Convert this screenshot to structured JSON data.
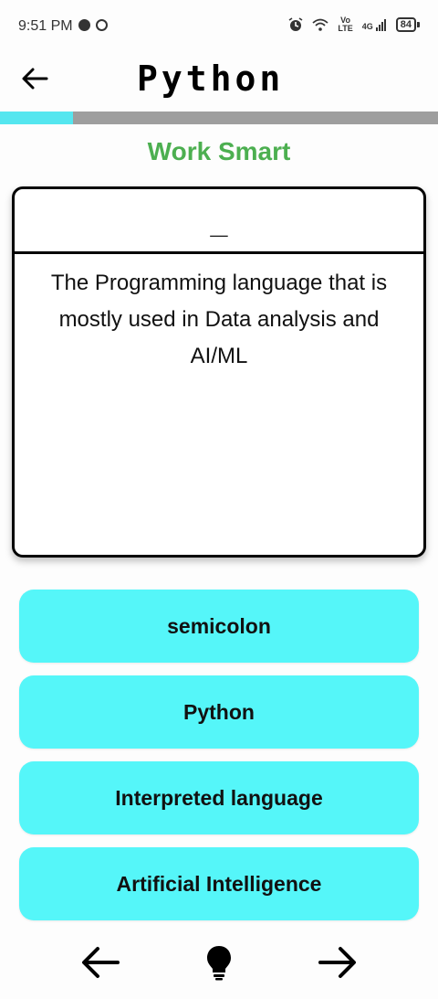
{
  "status_bar": {
    "time": "9:51 PM",
    "left_icons": [
      "messenger-icon",
      "notification-icon"
    ],
    "right_icons": [
      "alarm-icon",
      "wifi-icon",
      "volte-icon",
      "signal-4g-icon"
    ],
    "vo_label": "Vo",
    "lte_label": "LTE",
    "network_label": "4G",
    "battery": "84"
  },
  "header": {
    "title": "Python"
  },
  "progress": {
    "fraction": 0.167,
    "fill_color": "#55e6ef",
    "track_color": "#9e9e9e"
  },
  "subtitle": "Work Smart",
  "card": {
    "answer": "_",
    "question": "The Programming language that is mostly used in Data analysis and AI/ML"
  },
  "options": [
    {
      "label": "semicolon"
    },
    {
      "label": "Python"
    },
    {
      "label": "Interpreted language"
    },
    {
      "label": "Artificial Intelligence"
    }
  ],
  "bottom_nav": {
    "icons": [
      "arrow-left-icon",
      "lightbulb-icon",
      "arrow-right-icon"
    ]
  },
  "colors": {
    "accent_green": "#4caf50",
    "option_bg": "#55f6f9"
  }
}
